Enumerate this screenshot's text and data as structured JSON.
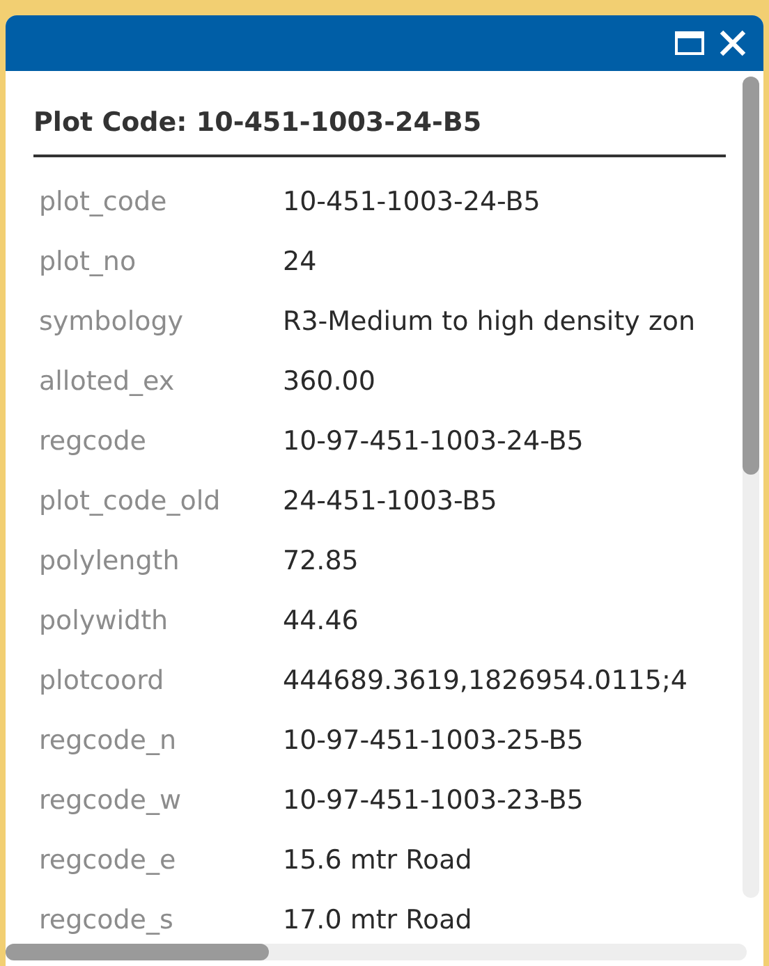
{
  "popup": {
    "title": "Plot Code: 10-451-1003-24-B5",
    "fields": [
      {
        "label": "plot_code",
        "value": "10-451-1003-24-B5"
      },
      {
        "label": "plot_no",
        "value": "24"
      },
      {
        "label": "symbology",
        "value": "R3-Medium to high density zon"
      },
      {
        "label": "alloted_ex",
        "value": "360.00"
      },
      {
        "label": "regcode",
        "value": "10-97-451-1003-24-B5"
      },
      {
        "label": "plot_code_old",
        "value": "24-451-1003-B5"
      },
      {
        "label": "polylength",
        "value": "72.85"
      },
      {
        "label": "polywidth",
        "value": "44.46"
      },
      {
        "label": "plotcoord",
        "value": "444689.3619,1826954.0115;4"
      },
      {
        "label": "regcode_n",
        "value": "10-97-451-1003-25-B5"
      },
      {
        "label": "regcode_w",
        "value": "10-97-451-1003-23-B5"
      },
      {
        "label": "regcode_e",
        "value": "15.6 mtr Road"
      },
      {
        "label": "regcode_s",
        "value": "17.0 mtr Road"
      }
    ]
  }
}
